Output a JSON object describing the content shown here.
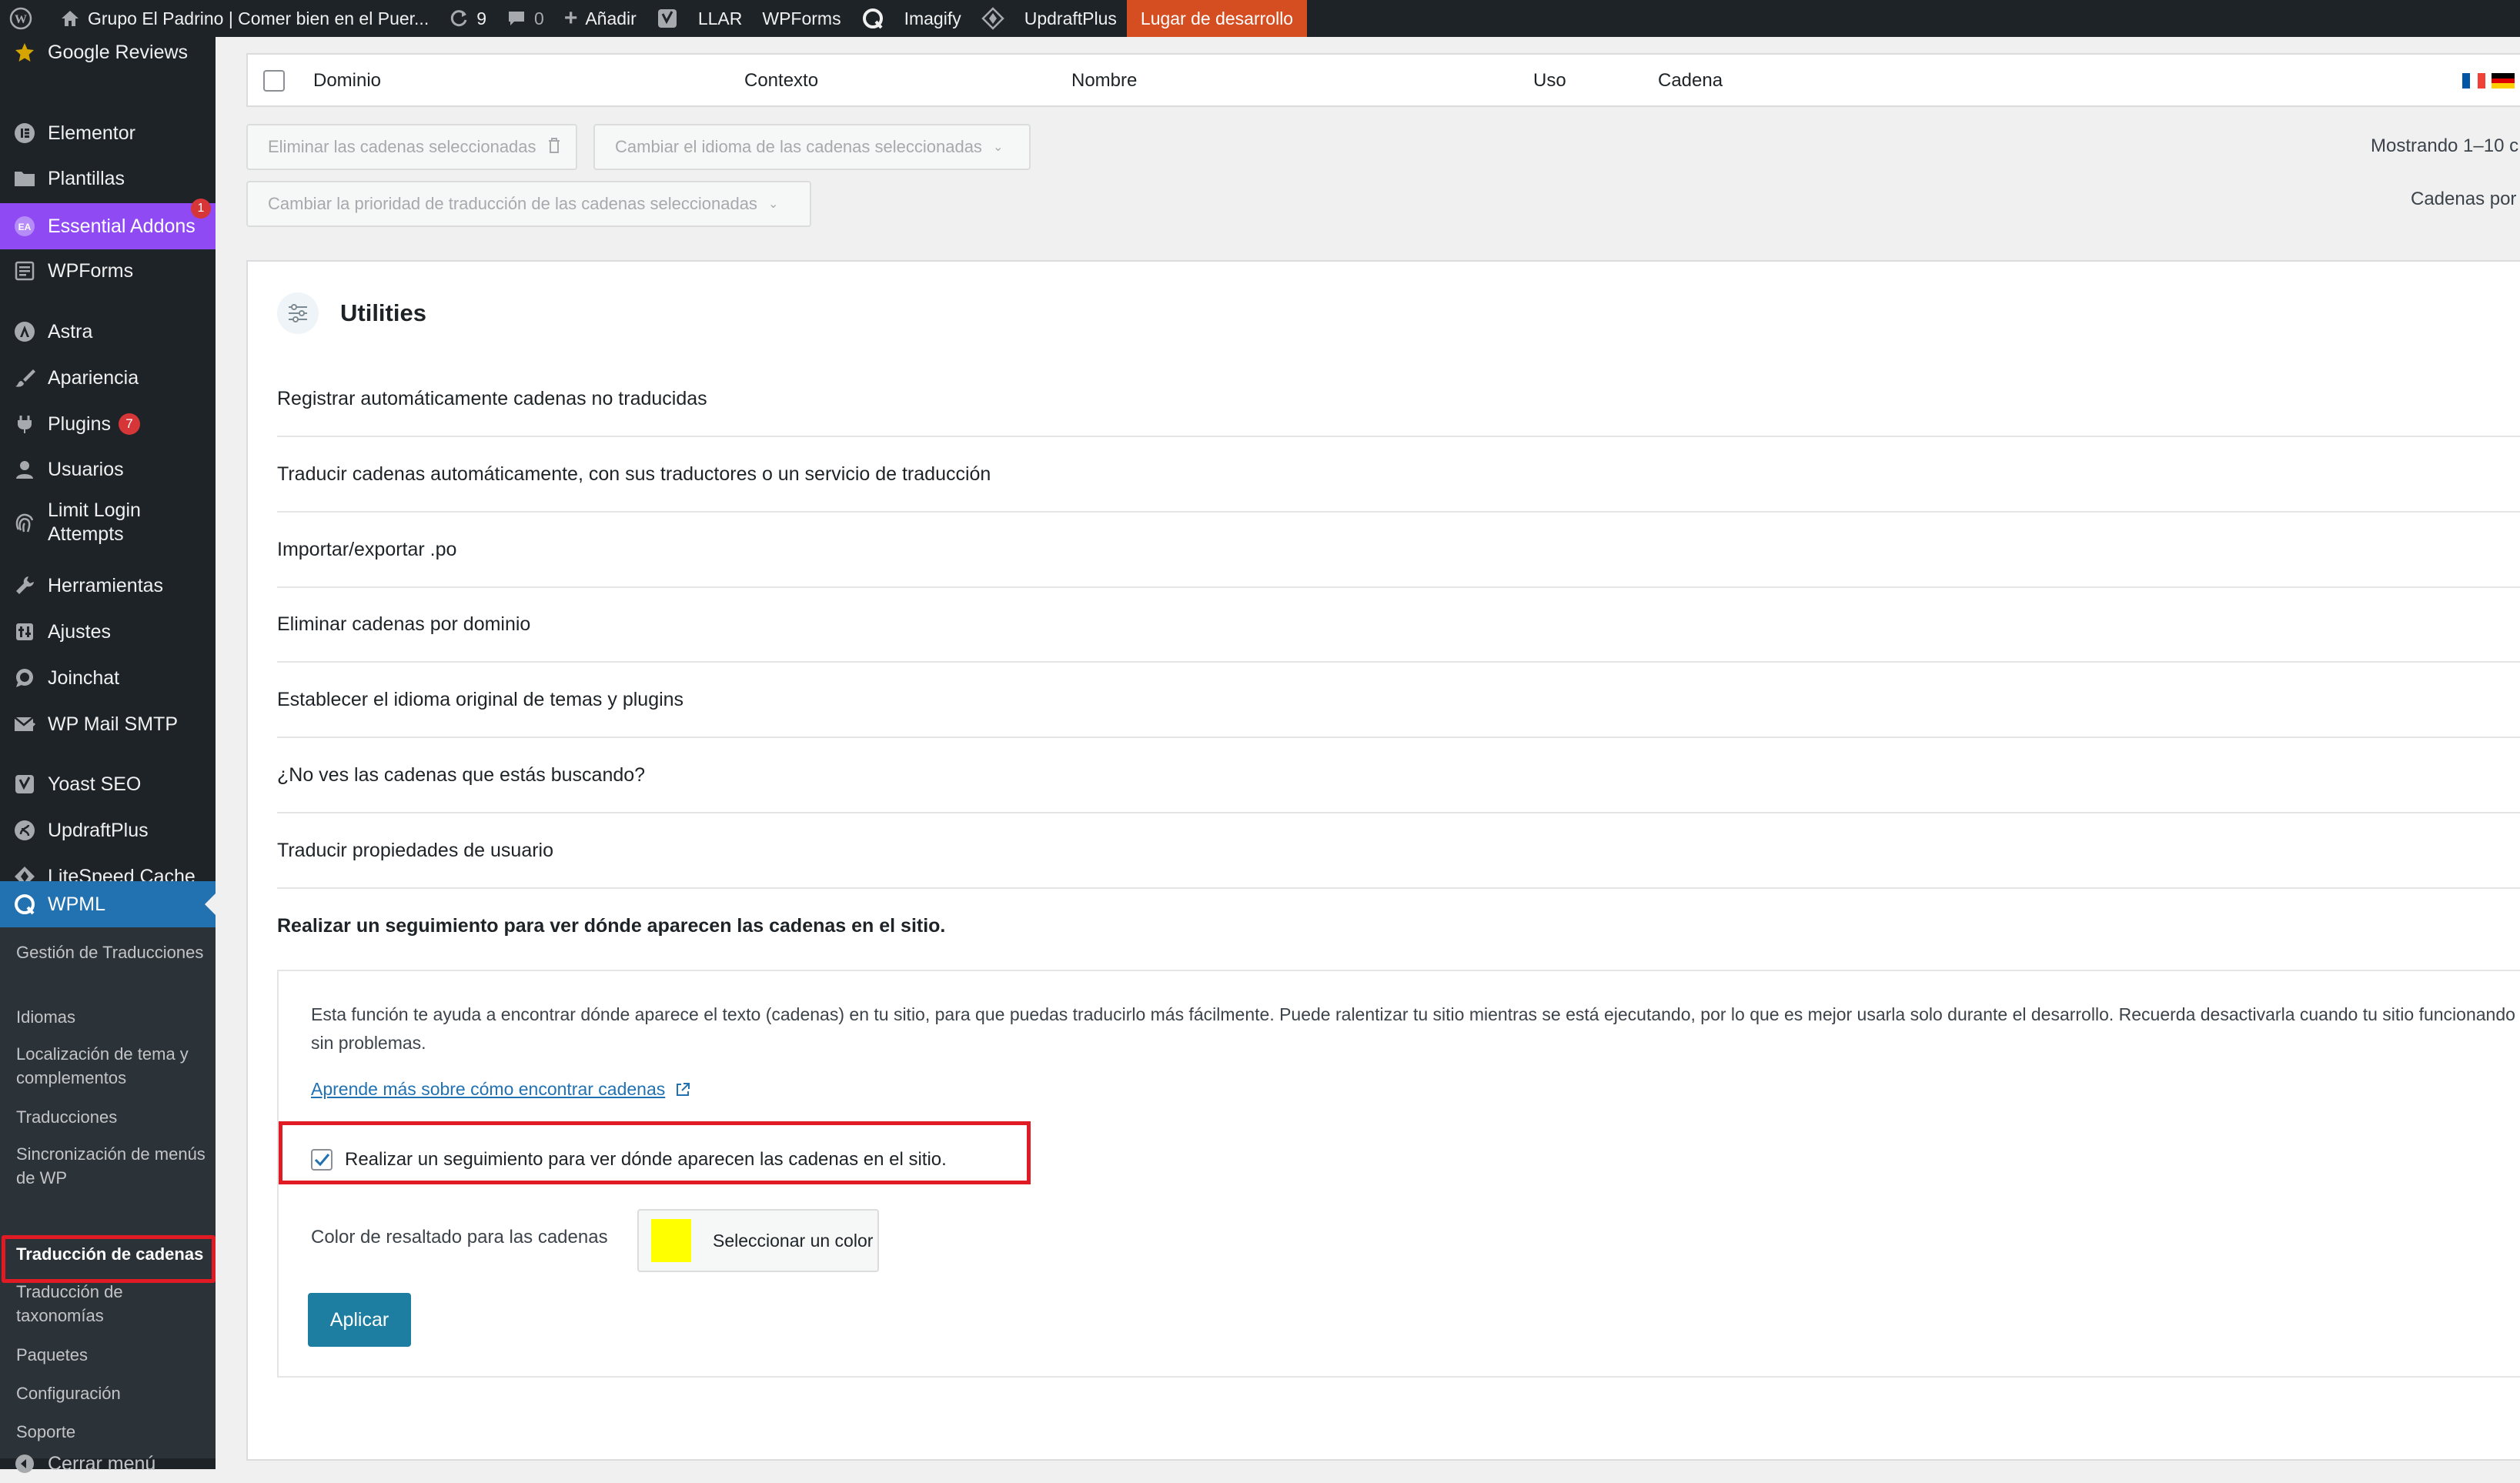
{
  "admin_bar": {
    "site_name": "Grupo El Padrino | Comer bien en el Puer...",
    "updates_count": "9",
    "comments_count": "0",
    "add_new": "Añadir",
    "llar": "LLAR",
    "wpforms": "WPForms",
    "imagify": "Imagify",
    "updraftplus": "UpdraftPlus",
    "dev_site": "Lugar de desarrollo"
  },
  "sidebar": {
    "items": [
      {
        "label": "Google Reviews",
        "icon": "star-icon"
      },
      {
        "label": "Elementor",
        "icon": "elementor-icon"
      },
      {
        "label": "Plantillas",
        "icon": "folder-icon"
      },
      {
        "label": "Essential Addons",
        "icon": "ea-icon",
        "badge": "1"
      },
      {
        "label": "WPForms",
        "icon": "form-icon"
      },
      {
        "label": "Astra",
        "icon": "astra-icon"
      },
      {
        "label": "Apariencia",
        "icon": "brush-icon"
      },
      {
        "label": "Plugins",
        "icon": "plug-icon",
        "badge": "7"
      },
      {
        "label": "Usuarios",
        "icon": "user-icon"
      },
      {
        "label": "Limit Login Attempts",
        "icon": "fingerprint-icon"
      },
      {
        "label": "Herramientas",
        "icon": "wrench-icon"
      },
      {
        "label": "Ajustes",
        "icon": "settings-icon"
      },
      {
        "label": "Joinchat",
        "icon": "chat-icon"
      },
      {
        "label": "WP Mail SMTP",
        "icon": "mail-icon"
      },
      {
        "label": "Yoast SEO",
        "icon": "yoast-icon"
      },
      {
        "label": "UpdraftPlus",
        "icon": "updraft-icon"
      },
      {
        "label": "LiteSpeed Cache",
        "icon": "litespeed-icon"
      },
      {
        "label": "WPML",
        "icon": "wpml-icon"
      }
    ],
    "submenu": [
      "Gestión de Traducciones",
      "Idiomas",
      "Localización de tema y complementos",
      "Traducciones",
      "Sincronización de menús de WP",
      "Traducción de cadenas",
      "Traducción de taxonomías",
      "Paquetes",
      "Configuración",
      "Soporte"
    ],
    "collapse": "Cerrar menú"
  },
  "table": {
    "columns": [
      "Dominio",
      "Contexto",
      "Nombre",
      "Uso",
      "Cadena"
    ]
  },
  "bulk": {
    "delete": "Eliminar las cadenas seleccionadas",
    "change_language": "Cambiar el idioma de las cadenas seleccionadas",
    "change_priority": "Cambiar la prioridad de traducción de las cadenas seleccionadas",
    "showing": "Mostrando 1–10 c",
    "per_page": "Cadenas por"
  },
  "utilities": {
    "title": "Utilities",
    "rows": [
      "Registrar automáticamente cadenas no traducidas",
      "Traducir cadenas automáticamente, con sus traductores o un servicio de traducción",
      "Importar/exportar .po",
      "Eliminar cadenas por dominio",
      "Establecer el idioma original de temas y plugins",
      "¿No ves las cadenas que estás buscando?",
      "Traducir propiedades de usuario",
      "Realizar un seguimiento para ver dónde aparecen las cadenas en el sitio."
    ],
    "tracking": {
      "description": "Esta función te ayuda a encontrar dónde aparece el texto (cadenas) en tu sitio, para que puedas traducirlo más fácilmente. Puede ralentizar tu sitio mientras se está ejecutando, por lo que es mejor usarla solo durante el desarrollo. Recuerda desactivarla cuando tu sitio funcionando sin problemas.",
      "learn_more": "Aprende más sobre cómo encontrar cadenas",
      "checkbox_label": "Realizar un seguimiento para ver dónde aparecen las cadenas en el sitio.",
      "checked": true,
      "color_label": "Color de resaltado para las cadenas",
      "color_button": "Seleccionar un color",
      "highlight_color": "#ffff00",
      "apply": "Aplicar"
    }
  },
  "colors": {
    "admin_dark": "#1d2327",
    "wpml_blue": "#2271b1",
    "essential_addons": "#8f4af4",
    "dev_badge": "#d54e21",
    "highlight_border": "#e01b24",
    "apply_button": "#1e7ea1"
  }
}
